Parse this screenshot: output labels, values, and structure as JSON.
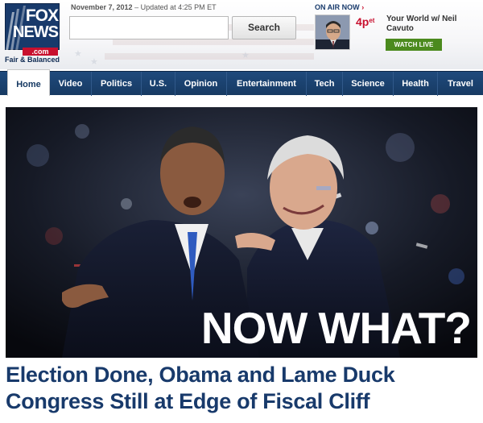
{
  "header": {
    "logo": {
      "line1": "FOX",
      "line2": "NEWS",
      "domain": ".com",
      "tagline": "Fair & Balanced"
    },
    "dateline": {
      "date": "November 7, 2012",
      "updated": "– Updated at 4:25 PM ET"
    },
    "search": {
      "placeholder": "",
      "button_label": "Search"
    },
    "on_air": {
      "label": "ON AIR NOW",
      "arrow": "›",
      "time": "4p",
      "time_suffix": "et",
      "show": "Your World w/ Neil Cavuto",
      "watch_label": "WATCH LIVE"
    }
  },
  "nav": {
    "items": [
      {
        "label": "Home"
      },
      {
        "label": "Video"
      },
      {
        "label": "Politics"
      },
      {
        "label": "U.S."
      },
      {
        "label": "Opinion"
      },
      {
        "label": "Entertainment"
      },
      {
        "label": "Tech"
      },
      {
        "label": "Science"
      },
      {
        "label": "Health"
      },
      {
        "label": "Travel"
      }
    ],
    "active": "Home"
  },
  "hero": {
    "caption": "NOW WHAT?",
    "headline": "Election Done, Obama and Lame Duck Congress Still at Edge of Fiscal Cliff"
  },
  "colors": {
    "brand_navy": "#183a6b",
    "brand_red": "#c8102e",
    "live_green": "#4b8a1e"
  }
}
